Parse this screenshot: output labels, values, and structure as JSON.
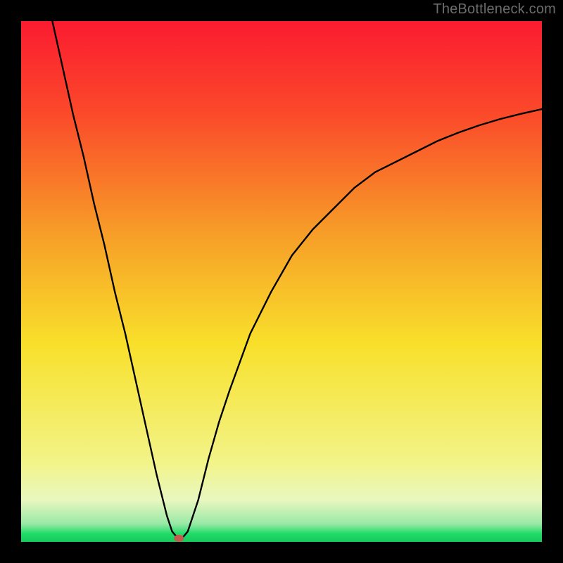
{
  "watermark": "TheBottleneck.com",
  "chart_data": {
    "type": "line",
    "title": "",
    "xlabel": "",
    "ylabel": "",
    "xlim": [
      0,
      100
    ],
    "ylim": [
      0,
      100
    ],
    "grid": false,
    "legend": false,
    "background_gradient": {
      "top_color": "#fb1b30",
      "mid_color": "#f8e02a",
      "bottom_green_band": "#1ddb67",
      "bottom_edge": "#18c95e"
    },
    "series": [
      {
        "name": "bottleneck-curve",
        "color": "#000000",
        "x": [
          6,
          8,
          10,
          12,
          14,
          16,
          18,
          20,
          22,
          24,
          26,
          27,
          28,
          29,
          30,
          31,
          32,
          34,
          36,
          38,
          40,
          44,
          48,
          52,
          56,
          60,
          64,
          68,
          72,
          76,
          80,
          84,
          88,
          92,
          96,
          100
        ],
        "y": [
          100,
          91,
          82,
          74,
          65,
          57,
          48,
          40,
          31,
          22,
          13,
          9,
          5,
          2,
          0.8,
          0.8,
          2,
          8,
          16,
          23,
          29,
          40,
          48,
          55,
          60,
          64,
          68,
          71,
          73,
          75,
          77,
          78.6,
          80,
          81.2,
          82.2,
          83.1
        ]
      }
    ],
    "marker": {
      "name": "optimal-point",
      "x": 30.3,
      "y": 0.7,
      "color": "#c45a4f",
      "rx": 7,
      "ry": 5
    }
  }
}
